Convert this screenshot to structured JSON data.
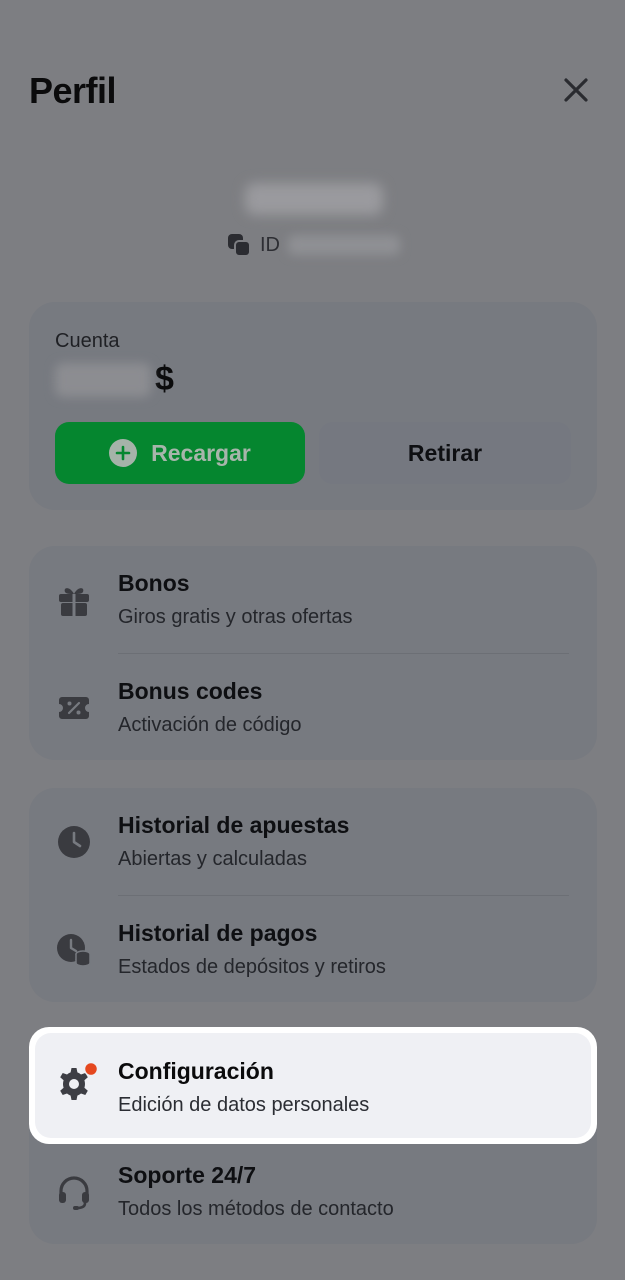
{
  "header": {
    "title": "Perfil"
  },
  "user": {
    "id_label": "ID"
  },
  "account": {
    "label": "Cuenta",
    "currency": "$",
    "recharge_label": "Recargar",
    "withdraw_label": "Retirar"
  },
  "menu": {
    "bonos": {
      "title": "Bonos",
      "subtitle": "Giros gratis y otras ofertas",
      "icon": "gift-icon"
    },
    "bonus_codes": {
      "title": "Bonus codes",
      "subtitle": "Activación de código",
      "icon": "coupon-icon"
    },
    "bet_history": {
      "title": "Historial de apuestas",
      "subtitle": "Abiertas y calculadas",
      "icon": "clock-icon"
    },
    "payment_history": {
      "title": "Historial de pagos",
      "subtitle": "Estados de depósitos y retiros",
      "icon": "payment-clock-icon"
    },
    "settings": {
      "title": "Configuración",
      "subtitle": "Edición de datos personales",
      "icon": "gear-icon"
    },
    "support": {
      "title": "Soporte 24/7",
      "subtitle": "Todos los métodos de contacto",
      "icon": "headset-icon"
    }
  },
  "colors": {
    "overlay": "#7d7e82",
    "card": "#777a80",
    "accent_green": "#05862f",
    "badge_red": "#e5481f",
    "highlight": "#eff0f4"
  }
}
